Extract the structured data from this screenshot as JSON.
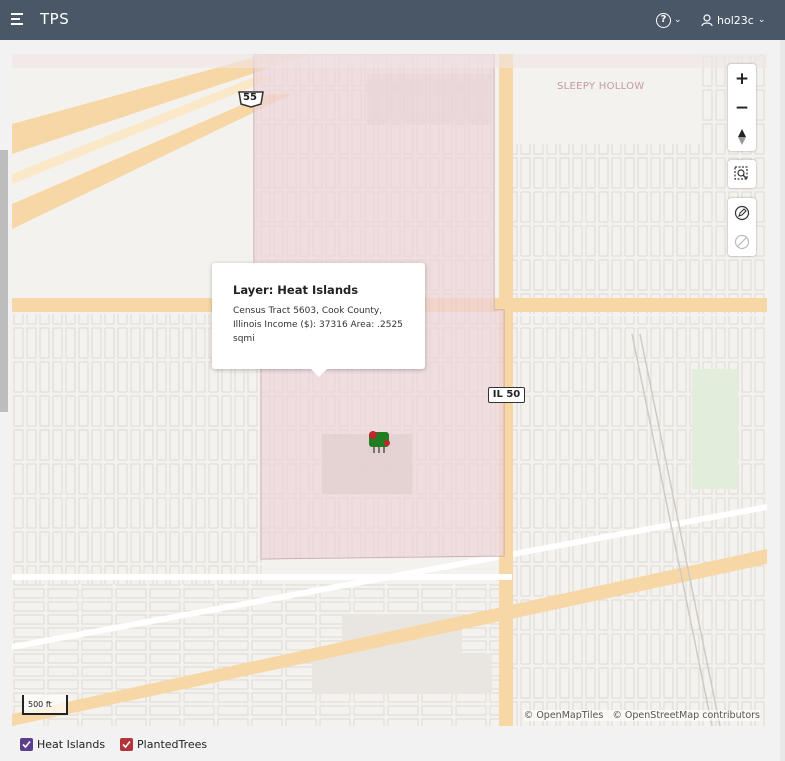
{
  "app": {
    "title": "TPS",
    "user": "hol23c"
  },
  "icons": {
    "menu": "hamburger-icon",
    "help": "help-icon",
    "user": "user-icon"
  },
  "map": {
    "area_label": "SLEEPY HOLLOW",
    "route_shields": [
      "55",
      "IL 50"
    ],
    "scale_label": "500 ft",
    "attribution": [
      "© OpenMapTiles",
      "© OpenStreetMap contributors"
    ],
    "controls": [
      "zoom-in",
      "zoom-out",
      "rotate-north",
      "zoom-to-selection",
      "draw",
      "clear"
    ]
  },
  "popup": {
    "title": "Layer: Heat Islands",
    "body": "Census Tract 5603, Cook County, Illinois Income ($): 37316 Area: .2525 sqmi"
  },
  "legend": [
    {
      "label": "Heat Islands",
      "color": "#5b3f8c",
      "checked": true
    },
    {
      "label": "PlantedTrees",
      "color": "#b3343b",
      "checked": true
    }
  ]
}
